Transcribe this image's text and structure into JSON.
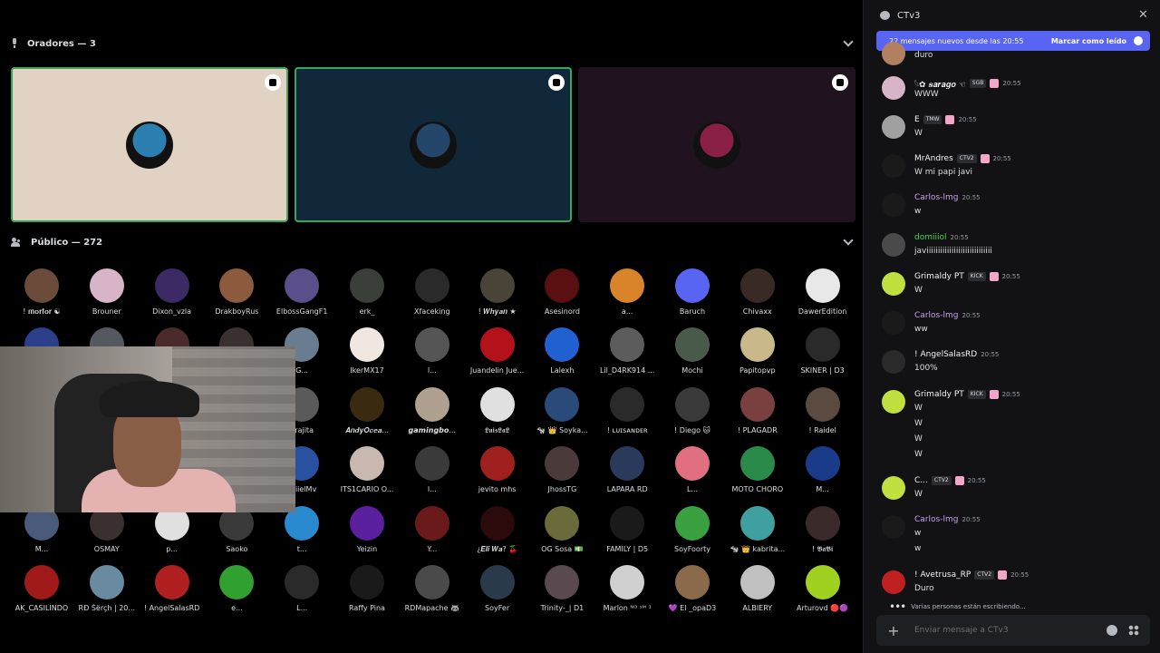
{
  "stage": {
    "speakers_label": "Oradores — 3",
    "audience_label": "Público — 272",
    "speakers": [
      {
        "bg": "#e2d2c4",
        "border": "#3ba55d",
        "avatar_color": "#2c7fb0"
      },
      {
        "bg": "#11283a",
        "border": "#3ba55d",
        "avatar_color": "#24466b"
      },
      {
        "bg": "#20121e",
        "border": "#20121e",
        "avatar_color": "#8a1f46"
      }
    ]
  },
  "audience": [
    {
      "name": "! 𝐦𝐨𝐫𝐟𝐨𝐫 ☯",
      "color": "#6b4c3b"
    },
    {
      "name": "Brouner",
      "color": "#d8b4c8"
    },
    {
      "name": "Dixon_vzla",
      "color": "#3b2a63"
    },
    {
      "name": "DrakboyRus",
      "color": "#8c5a3c"
    },
    {
      "name": "ElbossGangF1",
      "color": "#5a4f8a"
    },
    {
      "name": "erk_",
      "color": "#3a3f3a"
    },
    {
      "name": "Xfaceking",
      "color": "#2a2a2a"
    },
    {
      "name": "! 𝑾𝒉𝒚𝒂𝒏 ★",
      "color": "#4a4438"
    },
    {
      "name": "Asesinord",
      "color": "#5a1010"
    },
    {
      "name": "a...",
      "color": "#d9832b"
    },
    {
      "name": "Baruch",
      "color": "#5865f2"
    },
    {
      "name": "Chivaxx",
      "color": "#3a2a26"
    },
    {
      "name": "DawerEdition",
      "color": "#e8e8e8"
    },
    {
      "name": "",
      "color": "#2c3f8a"
    },
    {
      "name": "",
      "color": "#55585e"
    },
    {
      "name": "",
      "color": "#4a2a2a"
    },
    {
      "name": "",
      "color": "#3a3030"
    },
    {
      "name": "G...",
      "color": "#6a7c90"
    },
    {
      "name": "IkerMX17",
      "color": "#f0e8e0"
    },
    {
      "name": "l...",
      "color": "#555"
    },
    {
      "name": "Juandelin Jue...",
      "color": "#b3121a"
    },
    {
      "name": "Lalexh",
      "color": "#2060d0"
    },
    {
      "name": "Lil_D4RK914 ...",
      "color": "#5c5c5c"
    },
    {
      "name": "Mochi",
      "color": "#4a5a4a"
    },
    {
      "name": "Papitopvp",
      "color": "#c8b88a"
    },
    {
      "name": "SKINER | D3",
      "color": "#2a2a2a"
    },
    {
      "name": "",
      "color": "#333"
    },
    {
      "name": "",
      "color": "#333"
    },
    {
      "name": "",
      "color": "#333"
    },
    {
      "name": "",
      "color": "#333"
    },
    {
      "name": "arajita",
      "color": "#5a5a5a"
    },
    {
      "name": "𝑨𝒏𝒅𝒚𝑶𝒄𝒆𝒂...",
      "color": "#3a2a10"
    },
    {
      "name": "𝙜𝙖𝙢𝙞𝙣𝙜𝙗𝙤...",
      "color": "#b0a090"
    },
    {
      "name": "𝕷𝖚𝖎𝖘𝕷𝖆𝕷",
      "color": "#e0e0e0"
    },
    {
      "name": "🐄 👑 Soyka...",
      "color": "#2a4a7a"
    },
    {
      "name": "! ʟᴜɪsᴀɴᴅᴇʀ",
      "color": "#2a2a2a"
    },
    {
      "name": "! Diego 🐱",
      "color": "#3a3a3a"
    },
    {
      "name": "! PLAGADR",
      "color": "#7a4040"
    },
    {
      "name": "! Raidel",
      "color": "#5a4a40"
    },
    {
      "name": "",
      "color": "#333"
    },
    {
      "name": "",
      "color": "#333"
    },
    {
      "name": "",
      "color": "#333"
    },
    {
      "name": "",
      "color": "#333"
    },
    {
      "name": "BriielMv",
      "color": "#2a50a0"
    },
    {
      "name": "ITS1CARIO O...",
      "color": "#c8b8b0"
    },
    {
      "name": "l...",
      "color": "#3a3a3a"
    },
    {
      "name": "jevito mhs",
      "color": "#a02020"
    },
    {
      "name": "JhossTG",
      "color": "#4a3a3a"
    },
    {
      "name": "LAPARA RD",
      "color": "#2a3a5a"
    },
    {
      "name": "L...",
      "color": "#e07080"
    },
    {
      "name": "MOTO CHORO",
      "color": "#2a8a4a"
    },
    {
      "name": "M...",
      "color": "#1a3a8a"
    },
    {
      "name": "M...",
      "color": "#4a5a7a"
    },
    {
      "name": "OSMAY",
      "color": "#3a3030"
    },
    {
      "name": "p...",
      "color": "#e0e0e0"
    },
    {
      "name": "Saoko",
      "color": "#3a3a3a"
    },
    {
      "name": "t...",
      "color": "#2a8ad0"
    },
    {
      "name": "Yeizin",
      "color": "#5a20a0"
    },
    {
      "name": "Y...",
      "color": "#6a1a1a"
    },
    {
      "name": "¿𝑬𝒍𝒊 𝑾𝒂? 🍒",
      "color": "#2a0a0a"
    },
    {
      "name": "OG Sosa 💵",
      "color": "#6a6a3a"
    },
    {
      "name": "FAMILY | D5",
      "color": "#1a1a1a"
    },
    {
      "name": "SoyFoorty",
      "color": "#3aa040"
    },
    {
      "name": "🐄 👑 kabrita...",
      "color": "#40a0a0"
    },
    {
      "name": "! 𝕭𝖆𝕭𝖎",
      "color": "#3a2a2a"
    },
    {
      "name": "AK_CASILINDO",
      "color": "#a01a1a"
    },
    {
      "name": "RĐ Šërçh | 20...",
      "color": "#6a8aa0"
    },
    {
      "name": "! AngelSalasRD",
      "color": "#b02020"
    },
    {
      "name": "e...",
      "color": "#30a030"
    },
    {
      "name": "L...",
      "color": "#2a2a2a"
    },
    {
      "name": "Raffy Pina",
      "color": "#1a1a1a"
    },
    {
      "name": "RDMapache 🦝",
      "color": "#4a4a4a"
    },
    {
      "name": "SoyFer",
      "color": "#2a3a4a"
    },
    {
      "name": "Trinity-_| D1",
      "color": "#5a4a50"
    },
    {
      "name": "Marlon ᴺᴼ ˢᴹ ¹",
      "color": "#d0d0d0"
    },
    {
      "name": "💜 El _opaD3",
      "color": "#8a6a4a"
    },
    {
      "name": "ALBIERY",
      "color": "#c0c0c0"
    },
    {
      "name": "Arturovd 🔴🟣",
      "color": "#a0d020"
    }
  ],
  "chat": {
    "channel": "CTv3",
    "new_messages": "22 mensajes nuevos desde las 20:55",
    "mark_read": "Marcar como leído",
    "first_text": "duro",
    "messages": [
      {
        "name": "𓆩✿ 𝒔𝒂𝒓𝒂𝒈𝒐 ☜",
        "tag": "SGB",
        "time": "20:55",
        "lines": [
          "WWW"
        ],
        "color": "#d8b4c8",
        "name_color": "#f2f3f5"
      },
      {
        "name": "E",
        "tag": "TMW",
        "time": "20:55",
        "lines": [
          "W"
        ],
        "color": "#a0a0a0",
        "name_color": "#f2f3f5"
      },
      {
        "name": "MrAndres",
        "tag": "CTV2",
        "time": "20:55",
        "lines": [
          "W mi papi javi"
        ],
        "color": "#1a1a1a",
        "name_color": "#f2f3f5"
      },
      {
        "name": "Carlos-lmg",
        "tag": "",
        "time": "20:55",
        "lines": [
          "w"
        ],
        "color": "#1a1a1a",
        "name_color": "#c8a0f0"
      },
      {
        "name": "domiiiol",
        "tag": "",
        "time": "20:55",
        "lines": [
          "javiiiiiiiiiiiiiiiiiiiiiiiiiiiii"
        ],
        "color": "#4a4a4a",
        "name_color": "#4ad04a"
      },
      {
        "name": "Grimaldy PT",
        "tag": "KICK",
        "time": "20:55",
        "lines": [
          "W"
        ],
        "color": "#c0e040",
        "name_color": "#f2f3f5"
      },
      {
        "name": "Carlos-lmg",
        "tag": "",
        "time": "20:55",
        "lines": [
          "ww"
        ],
        "color": "#1a1a1a",
        "name_color": "#c8a0f0"
      },
      {
        "name": "! AngelSalasRD",
        "tag": "",
        "time": "20:55",
        "lines": [
          "100%"
        ],
        "color": "#2a2a2a",
        "name_color": "#f2f3f5"
      },
      {
        "name": "Grimaldy PT",
        "tag": "KICK",
        "time": "20:55",
        "lines": [
          "W",
          "W",
          "W",
          "W"
        ],
        "color": "#c0e040",
        "name_color": "#f2f3f5"
      },
      {
        "name": "C...",
        "tag": "CTV2",
        "time": "20:55",
        "lines": [
          "W"
        ],
        "color": "#c0e040",
        "name_color": "#f2f3f5"
      },
      {
        "name": "Carlos-lmg",
        "tag": "",
        "time": "20:55",
        "lines": [
          "w",
          "w"
        ],
        "color": "#1a1a1a",
        "name_color": "#c8a0f0"
      },
      {
        "name": "! Avetrusa_RP",
        "tag": "CTV2",
        "time": "20:55",
        "lines": [
          "Duro"
        ],
        "color": "#c02020",
        "name_color": "#f2f3f5"
      }
    ],
    "typing": "Varias personas están escribiendo...",
    "input_placeholder": "Enviar mensaje a CTv3"
  }
}
